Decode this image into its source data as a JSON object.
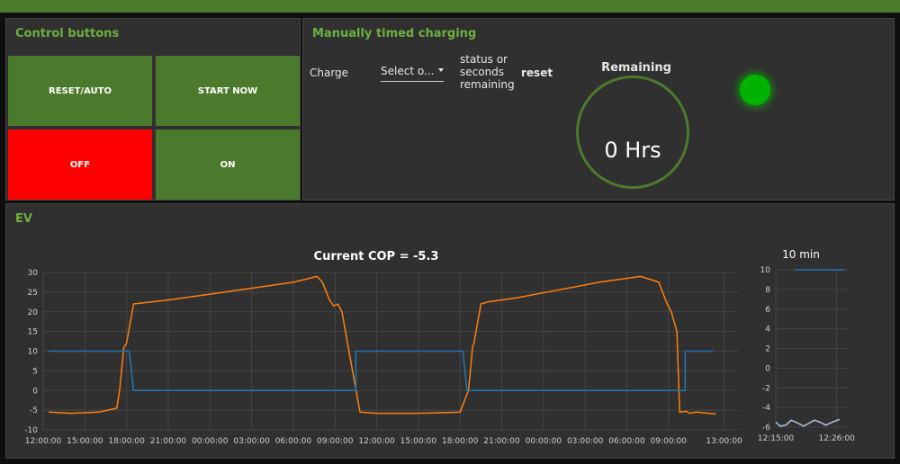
{
  "control": {
    "title": "Control buttons",
    "buttons": [
      "RESET/AUTO",
      "START NOW",
      "OFF",
      "ON"
    ]
  },
  "manual": {
    "title": "Manually timed charging",
    "charge_label": "Charge",
    "select_text": "Select o...",
    "status_label": "status or seconds remaining",
    "reset_label": "reset",
    "remaining_title": "Remaining",
    "remaining_value": "0 Hrs"
  },
  "colors": {
    "accent": "#6eaf3f",
    "off": "#ff0000",
    "button": "#4c7a2c",
    "led": "#00b300",
    "series_orange": "#ff7f0e",
    "series_blue": "#1f77b4"
  },
  "ev": {
    "title": "EV"
  },
  "chart_data": [
    {
      "type": "line",
      "title": "Current COP = -5.3",
      "xlabel": "",
      "ylabel": "",
      "x_tick_labels": [
        "12:00:00",
        "15:00:00",
        "18:00:00",
        "21:00:00",
        "00:00:00",
        "03:00:00",
        "06:00:00",
        "09:00:00",
        "12:00:00",
        "15:00:00",
        "18:00:00",
        "21:00:00",
        "00:00:00",
        "03:00:00",
        "06:00:00",
        "09:00:00",
        "13:00:00"
      ],
      "x_tick_hours": [
        0,
        3,
        6,
        9,
        12,
        15,
        18,
        21,
        24,
        27,
        30,
        33,
        36,
        39,
        42,
        45,
        49
      ],
      "xlim_hours": [
        0,
        50
      ],
      "y_ticks": [
        30,
        25,
        20,
        15,
        10,
        5,
        0,
        -5,
        -10
      ],
      "ylim": [
        -10,
        30
      ],
      "grid": true,
      "series": [
        {
          "color": "#ff7f0e",
          "x_hours": [
            0.4,
            2,
            4,
            5.3,
            5.5,
            5.8,
            6.0,
            6.5,
            7,
            9,
            12,
            15,
            18,
            19.7,
            20.1,
            20.6,
            20.9,
            21.2,
            21.5,
            22,
            22.8,
            24,
            27,
            30,
            30.6,
            30.9,
            31,
            31.5,
            32,
            34,
            37,
            40,
            43,
            44.3,
            44.9,
            45.2,
            45.6,
            45.8,
            46.3,
            46.5,
            47,
            48.4
          ],
          "values": [
            -5.5,
            -5.8,
            -5.5,
            -4.5,
            0,
            11,
            12,
            22,
            22.2,
            23,
            24.5,
            26,
            27.5,
            29,
            27.5,
            23,
            21.5,
            22,
            20,
            10,
            -5.5,
            -5.8,
            -5.8,
            -5.5,
            0,
            11,
            12,
            22,
            22.5,
            23.5,
            25.5,
            27.5,
            29,
            27.5,
            22,
            20,
            15,
            -5.5,
            -5.3,
            -5.8,
            -5.5,
            -6
          ]
        },
        {
          "color": "#1f77b4",
          "x_hours": [
            0.4,
            6.2,
            6.2,
            6.5,
            22.5,
            22.5,
            30.2,
            30.2,
            30.5,
            46.2,
            46.2,
            48.2
          ],
          "values": [
            10,
            10,
            10,
            0,
            0,
            10,
            10,
            10,
            0,
            0,
            10,
            10
          ]
        }
      ]
    },
    {
      "type": "line",
      "title": "10 min",
      "x_tick_labels": [
        "12:15:00",
        "12:26:00"
      ],
      "x_tick_min": [
        0,
        11
      ],
      "xlim_min": [
        0,
        13
      ],
      "y_ticks": [
        10,
        8,
        6,
        4,
        2,
        0,
        -2,
        -4,
        -6
      ],
      "ylim": [
        -6,
        10
      ],
      "grid": true,
      "series": [
        {
          "color": "#1f77b4",
          "x_min": [
            3.5,
            12.3
          ],
          "values": [
            10,
            10
          ]
        },
        {
          "color": "#aec7e8",
          "x_min": [
            0,
            0.8,
            1.8,
            2.8,
            4,
            5,
            6,
            7,
            8,
            9,
            10.2,
            11.5
          ],
          "values": [
            -5.5,
            -5.9,
            -5.8,
            -5.3,
            -5.6,
            -5.9,
            -5.6,
            -5.3,
            -5.5,
            -5.8,
            -5.5,
            -5.2
          ]
        }
      ]
    }
  ]
}
